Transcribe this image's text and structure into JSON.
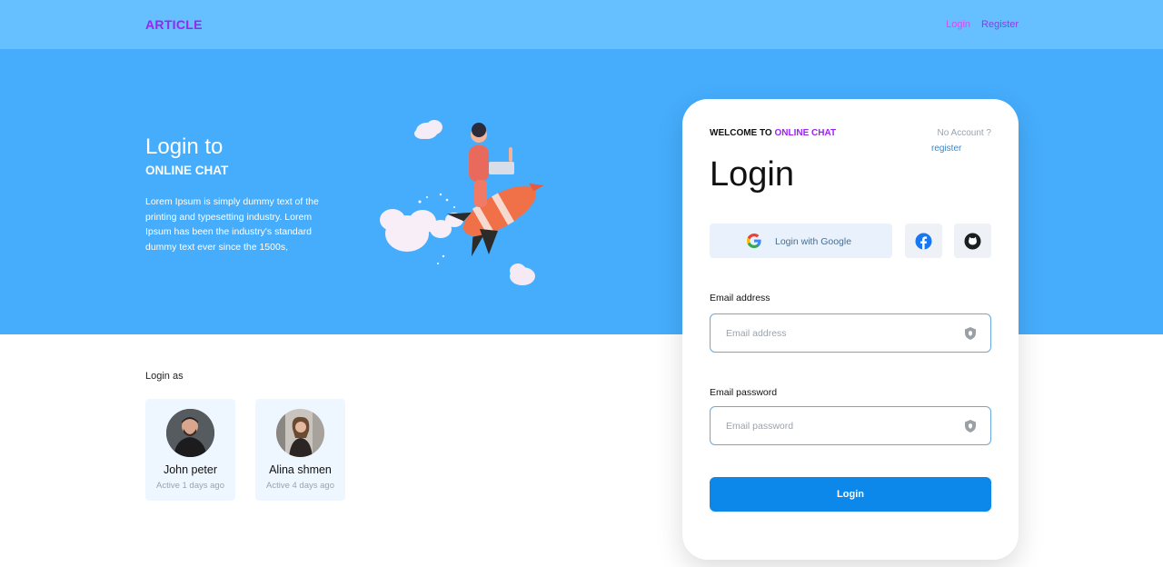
{
  "navbar": {
    "brand": "ARTICLE",
    "login_label": "Login",
    "register_label": "Register"
  },
  "hero": {
    "title": "Login to",
    "subtitle": "ONLINE CHAT",
    "description": "Lorem Ipsum is simply dummy text of the printing and typesetting industry. Lorem Ipsum has been the industry's standard dummy text ever since the 1500s,"
  },
  "login_as": {
    "heading": "Login as",
    "users": [
      {
        "name": "John peter",
        "status": "Active 1 days ago"
      },
      {
        "name": "Alina shmen",
        "status": "Active 4 days ago"
      }
    ]
  },
  "login_card": {
    "welcome_prefix": "WELCOME TO",
    "welcome_accent": "ONLINE CHAT",
    "no_account": "No Account ?",
    "register_link": "register",
    "title": "Login",
    "google_label": "Login with Google",
    "email_label": "Email address",
    "email_placeholder": "Email address",
    "password_label": "Email password",
    "password_placeholder": "Email password",
    "submit_label": "Login"
  },
  "colors": {
    "navbar_bg": "#66bfff",
    "hero_bg": "#45adfc",
    "brand": "#9b24f0",
    "primary_button": "#0c87ea"
  },
  "icons": [
    "google-icon",
    "facebook-icon",
    "github-icon",
    "shield-icon",
    "rocket-illustration",
    "cloud-icon"
  ]
}
